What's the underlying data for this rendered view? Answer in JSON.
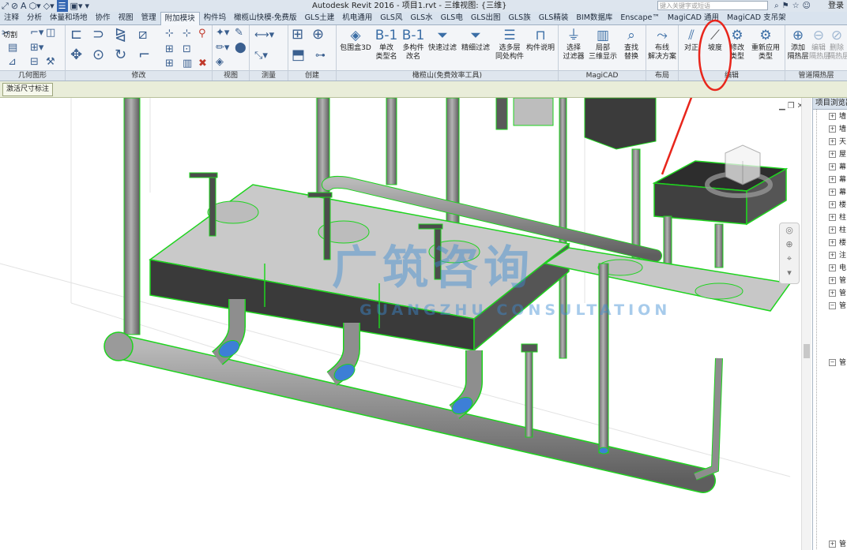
{
  "titlebar": {
    "title": "Autodesk Revit 2016 -     项目1.rvt - 三维视图: {三维}",
    "search_placeholder": "键入关键字或短语",
    "login": "登录"
  },
  "tabs": [
    "注释",
    "分析",
    "体量和场地",
    "协作",
    "视图",
    "管理",
    "附加模块",
    "构件坞",
    "橄榄山快模-免费版",
    "GLS土建",
    "机电通用",
    "GLS风",
    "GLS水",
    "GLS电",
    "GLS出图",
    "GLS族",
    "GLS精装",
    "BIM数据库",
    "Enscape™",
    "MagiCAD 通用",
    "MagiCAD 支吊架"
  ],
  "active_tab": "附加模块",
  "ribbon": {
    "geometry": {
      "label": "几何图形",
      "cut": "切割"
    },
    "modify": {
      "label": "修改"
    },
    "view": {
      "label": "视图"
    },
    "measure": {
      "label": "测量"
    },
    "create": {
      "label": "创建"
    },
    "gls": {
      "label": "橄榄山(免费效率工具)",
      "buttons": [
        {
          "l1": "包围盒3D",
          "l2": ""
        },
        {
          "l1": "单改",
          "l2": "类型名"
        },
        {
          "l1": "多构件",
          "l2": "改名"
        },
        {
          "l1": "快速过滤",
          "l2": ""
        },
        {
          "l1": "精细过滤",
          "l2": ""
        },
        {
          "l1": "选多层",
          "l2": "同处构件"
        },
        {
          "l1": "构件说明",
          "l2": ""
        }
      ]
    },
    "magicad": {
      "label": "MagiCAD",
      "buttons": [
        {
          "l1": "选择",
          "l2": "过滤器"
        },
        {
          "l1": "局部",
          "l2": "三维显示"
        },
        {
          "l1": "查找",
          "l2": "替换"
        }
      ]
    },
    "layout": {
      "label": "布局",
      "buttons": [
        {
          "l1": "布线",
          "l2": "解决方案"
        }
      ]
    },
    "edit": {
      "label": "编辑",
      "buttons": [
        {
          "l1": "对正",
          "l2": ""
        },
        {
          "l1": "坡度",
          "l2": ""
        },
        {
          "l1": "修改",
          "l2": "类型"
        },
        {
          "l1": "重新应用",
          "l2": "类型"
        }
      ]
    },
    "insulation": {
      "label": "管道隔热层",
      "buttons": [
        {
          "l1": "添加",
          "l2": "隔热层"
        },
        {
          "l1": "编辑",
          "l2": "隔热层"
        },
        {
          "l1": "删除",
          "l2": "隔热层"
        }
      ]
    }
  },
  "options_bar": {
    "button": "激活尺寸标注"
  },
  "watermark": {
    "cn": "广筑咨询",
    "en": "GUANGZHU CONSULTATION"
  },
  "browser": {
    "title": "项目浏览器",
    "items": [
      "墙",
      "墙",
      "天",
      "屋",
      "幕",
      "幕",
      "幕",
      "楼",
      "柱",
      "柱",
      "楼",
      "注",
      "电",
      "管",
      "管",
      "管",
      "管",
      "管"
    ]
  },
  "colors": {
    "selection": "#22e022",
    "pipe": "#8c8c8c",
    "highlight_pipe": "#3d7fd6",
    "annotation": "#e8261c"
  }
}
